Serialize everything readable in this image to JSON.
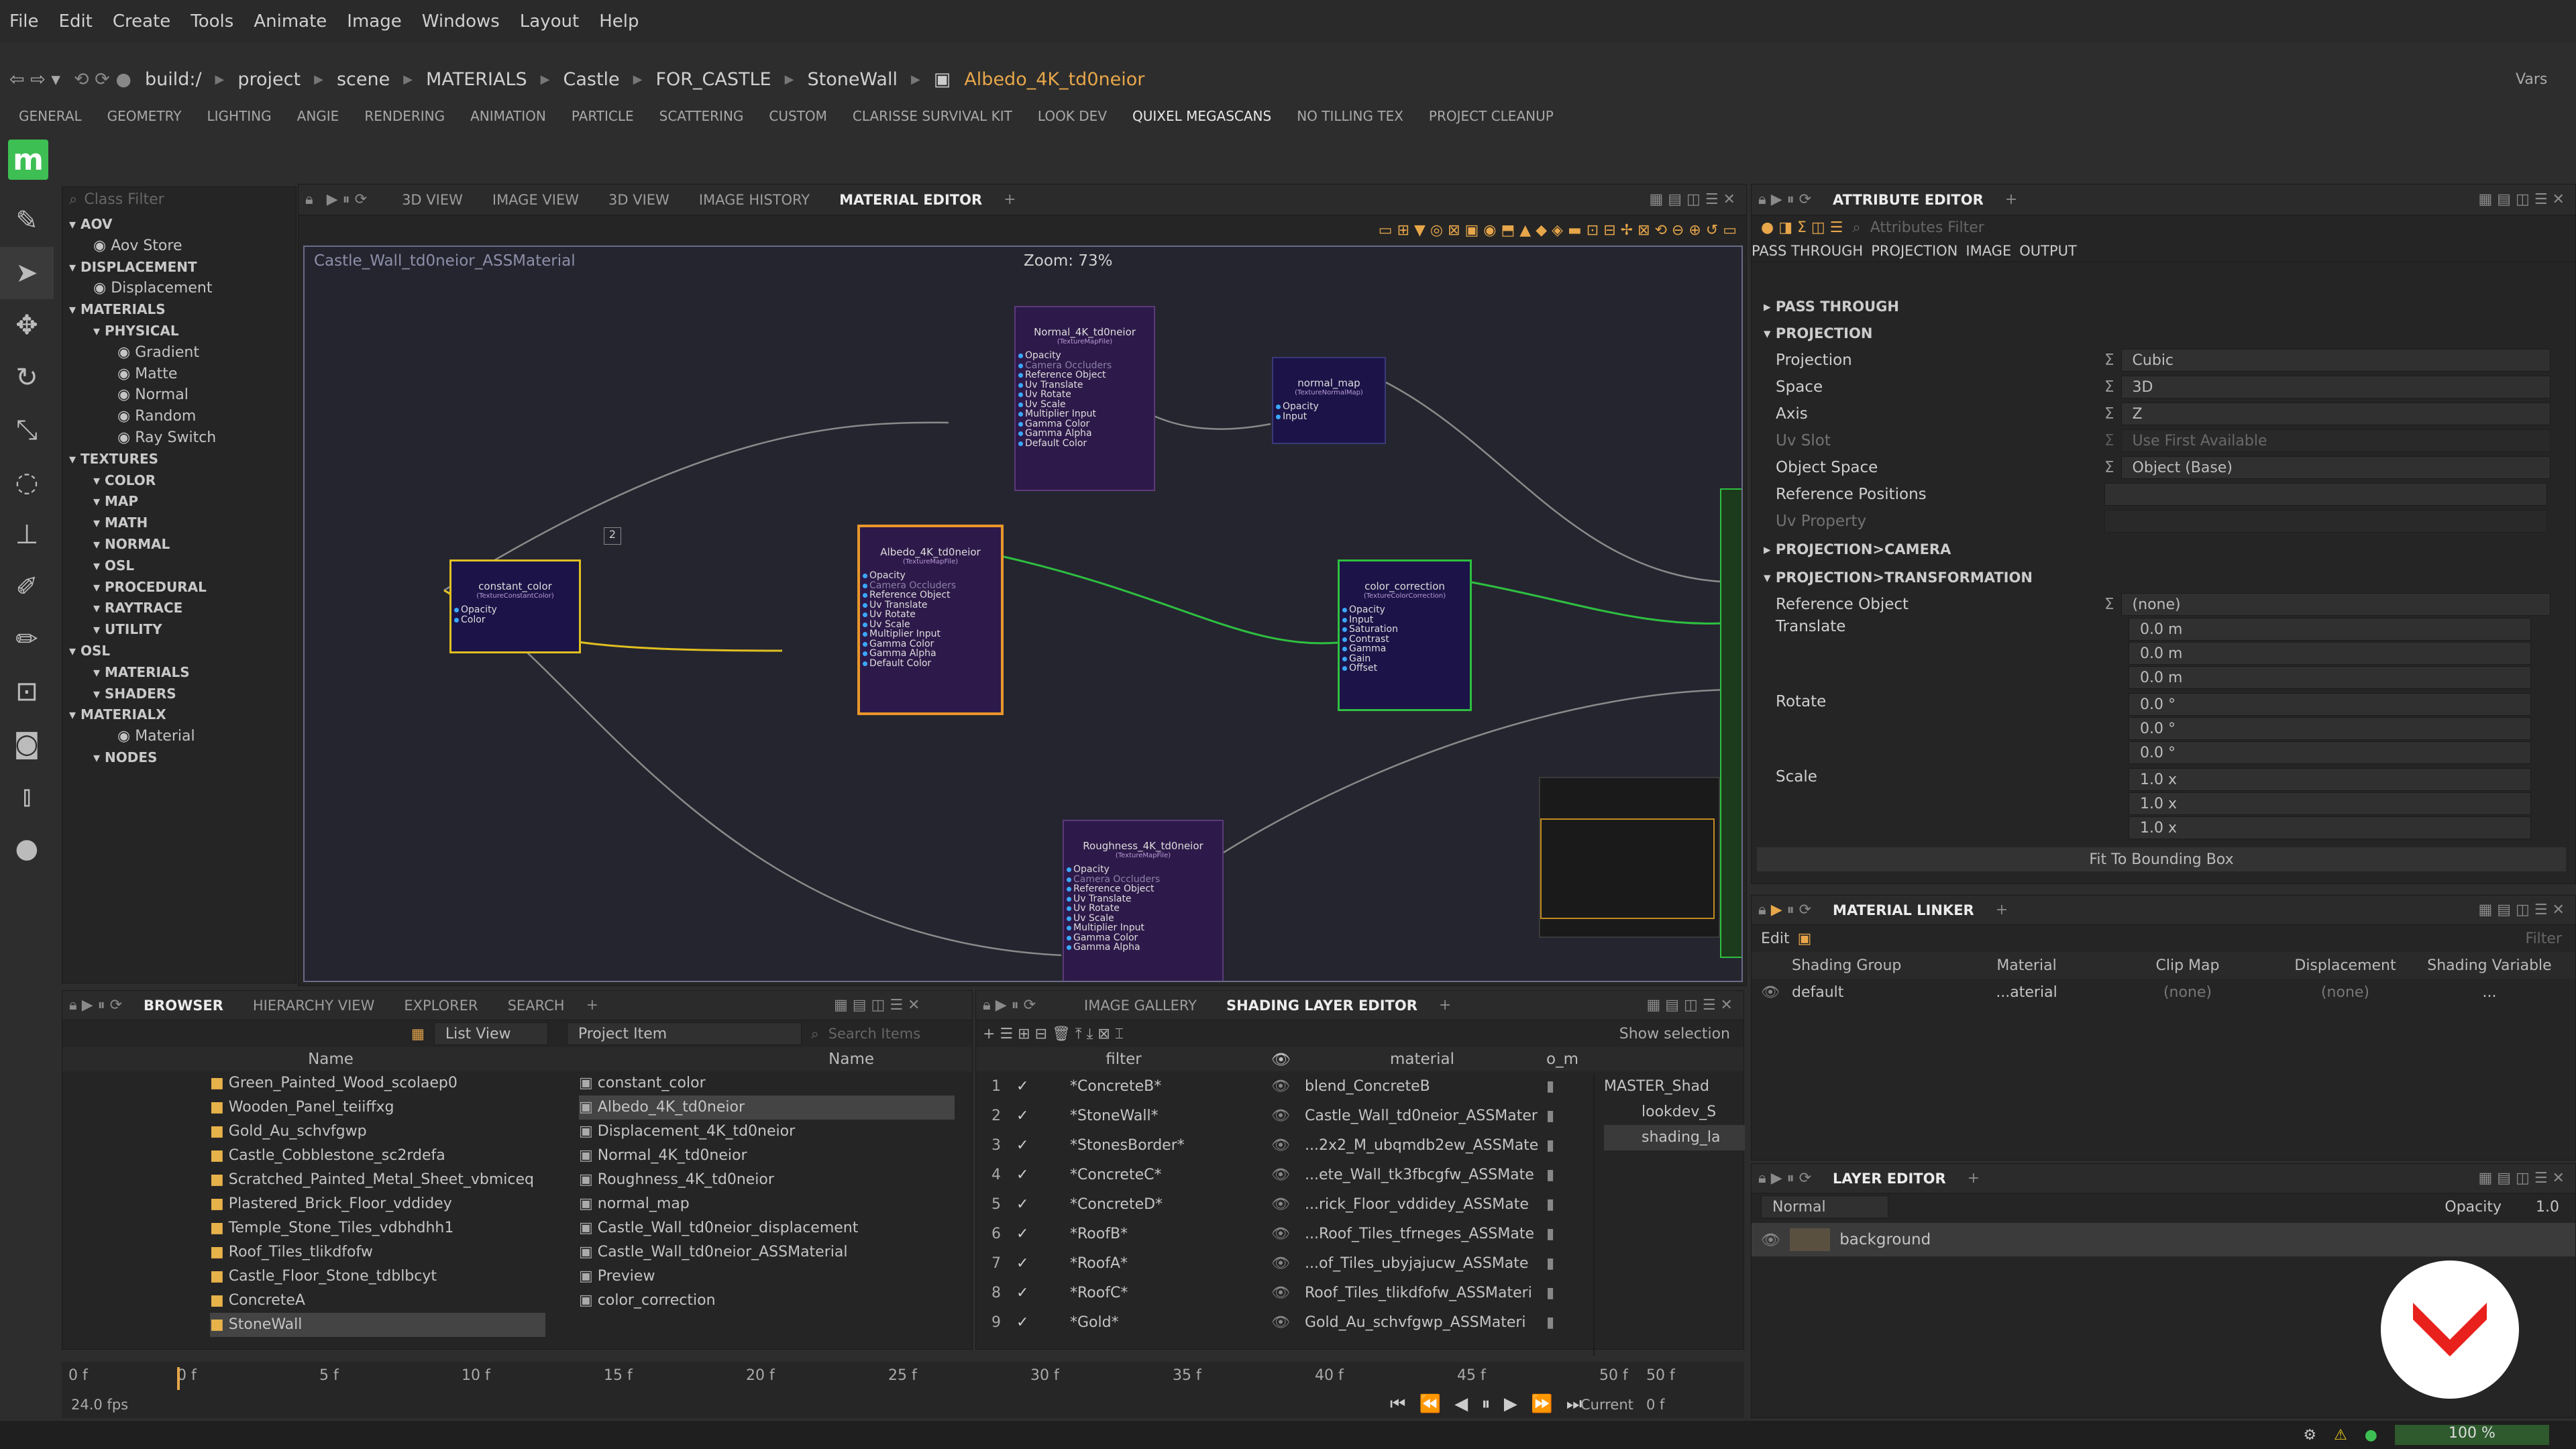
{
  "menu": [
    "File",
    "Edit",
    "Create",
    "Tools",
    "Animate",
    "Image",
    "Windows",
    "Layout",
    "Help"
  ],
  "path": [
    "build:/",
    "project",
    "scene",
    "MATERIALS",
    "Castle",
    "FOR_CASTLE",
    "StoneWall"
  ],
  "path_active": "Albedo_4K_td0neior",
  "vars": "Vars",
  "shelf": [
    "GENERAL",
    "GEOMETRY",
    "LIGHTING",
    "ANGIE",
    "RENDERING",
    "ANIMATION",
    "PARTICLE",
    "SCATTERING",
    "CUSTOM",
    "CLARISSE SURVIVAL KIT",
    "LOOK DEV",
    "QUIXEL MEGASCANS",
    "NO TILLING TEX",
    "PROJECT CLEANUP"
  ],
  "logo": "m",
  "viewTabs": [
    "3D VIEW",
    "IMAGE VIEW",
    "3D VIEW",
    "IMAGE HISTORY",
    "MATERIAL EDITOR"
  ],
  "classFilter": "Class Filter",
  "tree": [
    {
      "t": "AOV",
      "h": true,
      "d": 0
    },
    {
      "t": "Aov Store",
      "d": 1
    },
    {
      "t": "DISPLACEMENT",
      "h": true,
      "d": 0
    },
    {
      "t": "Displacement",
      "d": 1
    },
    {
      "t": "MATERIALS",
      "h": true,
      "d": 0
    },
    {
      "t": "PHYSICAL",
      "h": true,
      "d": 1
    },
    {
      "t": "Gradient",
      "d": 2
    },
    {
      "t": "Matte",
      "d": 2
    },
    {
      "t": "Normal",
      "d": 2
    },
    {
      "t": "Random",
      "d": 2
    },
    {
      "t": "Ray Switch",
      "d": 2
    },
    {
      "t": "TEXTURES",
      "h": true,
      "d": 0
    },
    {
      "t": "COLOR",
      "h": true,
      "d": 1
    },
    {
      "t": "MAP",
      "h": true,
      "d": 1
    },
    {
      "t": "MATH",
      "h": true,
      "d": 1
    },
    {
      "t": "NORMAL",
      "h": true,
      "d": 1
    },
    {
      "t": "OSL",
      "h": true,
      "d": 1
    },
    {
      "t": "PROCEDURAL",
      "h": true,
      "d": 1
    },
    {
      "t": "RAYTRACE",
      "h": true,
      "d": 1
    },
    {
      "t": "UTILITY",
      "h": true,
      "d": 1
    },
    {
      "t": "OSL",
      "h": true,
      "d": 0
    },
    {
      "t": "MATERIALS",
      "h": true,
      "d": 1
    },
    {
      "t": "SHADERS",
      "h": true,
      "d": 1
    },
    {
      "t": "MATERIALX",
      "h": true,
      "d": 0
    },
    {
      "t": "Material",
      "d": 2
    },
    {
      "t": "NODES",
      "h": true,
      "d": 1
    }
  ],
  "graph": {
    "context": "Castle_Wall_td0neior_ASSMaterial",
    "zoom": "Zoom: 73%",
    "badge": "2",
    "nodes": [
      {
        "id": "normal",
        "title": "Normal_4K_td0neior",
        "sub": "(TextureMapFile)",
        "ports": [
          "Opacity",
          "Camera Occluders",
          "Reference Object",
          "Uv Translate",
          "Uv Rotate",
          "Uv Scale",
          "Multiplier Input",
          "Gamma Color",
          "Gamma Alpha",
          "Default Color"
        ]
      },
      {
        "id": "nmap",
        "title": "normal_map",
        "sub": "(TextureNormalMap)",
        "ports": [
          "Opacity",
          "Input"
        ]
      },
      {
        "id": "const",
        "title": "constant_color",
        "sub": "(TextureConstantColor)",
        "ports": [
          "Opacity",
          "Color"
        ]
      },
      {
        "id": "albedo",
        "title": "Albedo_4K_td0neior",
        "sub": "(TextureMapFile)",
        "ports": [
          "Opacity",
          "Camera Occluders",
          "Reference Object",
          "Uv Translate",
          "Uv Rotate",
          "Uv Scale",
          "Multiplier Input",
          "Gamma Color",
          "Gamma Alpha",
          "Default Color"
        ]
      },
      {
        "id": "cc",
        "title": "color_correction",
        "sub": "(TextureColorCorrection)",
        "ports": [
          "Opacity",
          "Input",
          "Saturation",
          "Contrast",
          "Gamma",
          "Gain",
          "Offset"
        ]
      },
      {
        "id": "rough",
        "title": "Roughness_4K_td0neior",
        "sub": "(TextureMapFile)",
        "ports": [
          "Opacity",
          "Camera Occluders",
          "Reference Object",
          "Uv Translate",
          "Uv Rotate",
          "Uv Scale",
          "Multiplier Input",
          "Gamma Color",
          "Gamma Alpha"
        ]
      }
    ]
  },
  "attrTabs": [
    "ATTRIBUTE EDITOR"
  ],
  "attrFilter": "Attributes Filter",
  "attrSubTabs": [
    "PASS THROUGH",
    "PROJECTION",
    "IMAGE",
    "OUTPUT"
  ],
  "attr": {
    "sec1": "PASS THROUGH",
    "sec2": "PROJECTION",
    "rows": [
      {
        "l": "Projection",
        "v": "Cubic"
      },
      {
        "l": "Space",
        "v": "3D"
      },
      {
        "l": "Axis",
        "v": "Z"
      },
      {
        "l": "Uv Slot",
        "v": "Use First Available"
      },
      {
        "l": "Object Space",
        "v": "Object (Base)"
      },
      {
        "l": "Reference Positions",
        "v": ""
      },
      {
        "l": "Uv Property",
        "v": ""
      }
    ],
    "sec3": "PROJECTION>CAMERA",
    "sec4": "PROJECTION>TRANSFORMATION",
    "refObj": "Reference Object",
    "refVal": "(none)",
    "translate": "Translate",
    "tv": [
      "0.0 m",
      "0.0 m",
      "0.0 m"
    ],
    "rotate": "Rotate",
    "rv": [
      "0.0 °",
      "0.0 °",
      "0.0 °"
    ],
    "scale": "Scale",
    "sv": [
      "1.0 x",
      "1.0 x",
      "1.0 x"
    ],
    "fit": "Fit To Bounding Box"
  },
  "linker": {
    "tab": "MATERIAL LINKER",
    "edit": "Edit",
    "filter": "Filter",
    "cols": [
      "Shading Group",
      "Material",
      "Clip Map",
      "Displacement",
      "Shading Variable"
    ],
    "row": [
      "default",
      "...aterial",
      "(none)",
      "(none)",
      "..."
    ]
  },
  "layer": {
    "tab": "LAYER EDITOR",
    "mode": "Normal",
    "opacityLbl": "Opacity",
    "opacity": "1.0",
    "item": "background"
  },
  "browser": {
    "tabs": [
      "BROWSER",
      "HIERARCHY VIEW",
      "EXPLORER",
      "SEARCH"
    ],
    "view": "List View",
    "proj": "Project Item",
    "search": "Search Items",
    "colName": "Name",
    "folders": [
      "Green_Painted_Wood_scolaep0",
      "Wooden_Panel_teiiffxg",
      "Gold_Au_schvfgwp",
      "Castle_Cobblestone_sc2rdefa",
      "Scratched_Painted_Metal_Sheet_vbmiceq",
      "Plastered_Brick_Floor_vddidey",
      "Temple_Stone_Tiles_vdbhdhh1",
      "Roof_Tiles_tlikdfofw",
      "Castle_Floor_Stone_tdblbcyt",
      "ConcreteA",
      "StoneWall"
    ],
    "items": [
      "constant_color",
      "Albedo_4K_td0neior",
      "Displacement_4K_td0neior",
      "Normal_4K_td0neior",
      "Roughness_4K_td0neior",
      "normal_map",
      "Castle_Wall_td0neior_displacement",
      "Castle_Wall_td0neior_ASSMaterial",
      "Preview",
      "color_correction"
    ]
  },
  "shading": {
    "tabs": [
      "IMAGE GALLERY",
      "SHADING LAYER EDITOR"
    ],
    "show": "Show selection",
    "colFilter": "filter",
    "colMat": "material",
    "colM": "o_m",
    "rows": [
      [
        "1",
        "*ConcreteB*",
        "blend_ConcreteB"
      ],
      [
        "2",
        "*StoneWall*",
        "Castle_Wall_td0neior_ASSMater"
      ],
      [
        "3",
        "*StonesBorder*",
        "...2x2_M_ubqmdb2ew_ASSMate"
      ],
      [
        "4",
        "*ConcreteC*",
        "...ete_Wall_tk3fbcgfw_ASSMate"
      ],
      [
        "5",
        "*ConcreteD*",
        "...rick_Floor_vddidey_ASSMate"
      ],
      [
        "6",
        "*RoofB*",
        "...Roof_Tiles_tfrneges_ASSMate"
      ],
      [
        "7",
        "*RoofA*",
        "...of_Tiles_ubyjajucw_ASSMate"
      ],
      [
        "8",
        "*RoofC*",
        "Roof_Tiles_tlikdfofw_ASSMateri"
      ],
      [
        "9",
        "*Gold*",
        "Gold_Au_schvfgwp_ASSMateri"
      ]
    ],
    "tree": [
      "MASTER_Shad",
      "lookdev_S",
      "shading_la"
    ]
  },
  "timeline": {
    "ticks": [
      "0 f",
      "5 f",
      "10 f",
      "15 f",
      "20 f",
      "25 f",
      "30 f",
      "35 f",
      "40 f",
      "45 f",
      "50 f"
    ],
    "start": "0 f",
    "end": "50 f",
    "fps": "24.0 fps",
    "current": "Current",
    "cur": "0 f"
  },
  "status": {
    "zoom": "100 %"
  },
  "colors": {
    "accent": "#e7a64a",
    "albedoBorder": "#e8962a",
    "constBorder": "#e0c020",
    "ccBorder": "#2ec040",
    "logo": "#3dbf53"
  }
}
